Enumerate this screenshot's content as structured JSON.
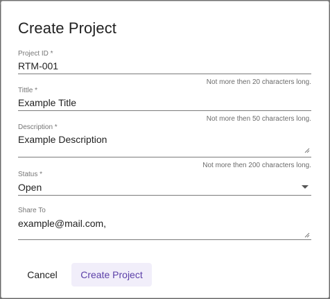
{
  "dialog": {
    "title": "Create Project"
  },
  "fields": {
    "project_id": {
      "label": "Project ID *",
      "value": "RTM-001",
      "hint": "Not more then 20 characters long."
    },
    "title": {
      "label": "Tittle *",
      "value": "Example Title",
      "hint": "Not more then 50 characters long."
    },
    "description": {
      "label": "Description *",
      "value": "Example Description",
      "hint": "Not more then 200 characters long."
    },
    "status": {
      "label": "Status *",
      "value": "Open"
    },
    "share_to": {
      "label": "Share To",
      "value": "example@mail.com,"
    }
  },
  "actions": {
    "cancel_label": "Cancel",
    "create_label": "Create Project"
  },
  "colors": {
    "accent": "#5b3fa8",
    "accent_bg": "#f1eefa"
  }
}
